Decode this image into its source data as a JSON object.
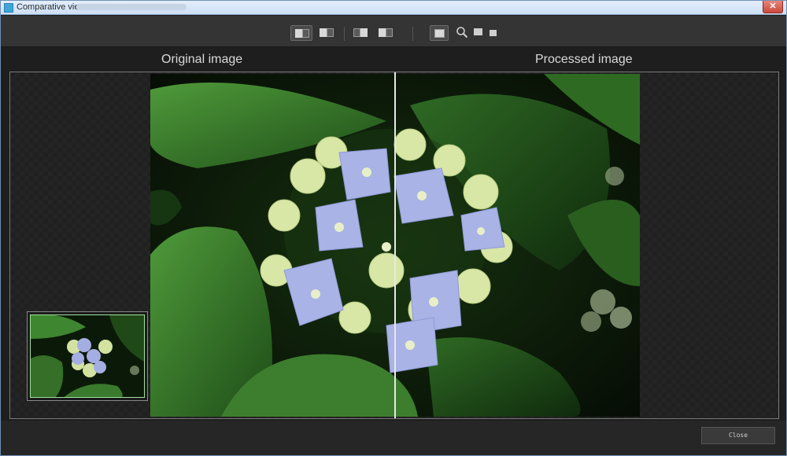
{
  "window": {
    "title": "Comparative view",
    "close_glyph": "✕"
  },
  "toolbar": {
    "buttons": [
      {
        "name": "split-view-vertical",
        "icon": "split-vertical-icon",
        "active": true
      },
      {
        "name": "split-view-alt",
        "icon": "split-alt-icon",
        "active": false
      },
      {
        "name": "side-by-side-left",
        "icon": "side-left-icon",
        "active": false
      },
      {
        "name": "side-by-side-right",
        "icon": "side-right-icon",
        "active": false
      },
      {
        "name": "single-view",
        "icon": "single-view-icon",
        "active": true
      },
      {
        "name": "zoom",
        "icon": "magnifier-icon",
        "active": false
      },
      {
        "name": "fit-to-window",
        "icon": "fit-icon",
        "active": false
      },
      {
        "name": "actual-size",
        "icon": "actual-size-icon",
        "active": false
      }
    ]
  },
  "labels": {
    "original": "Original image",
    "processed": "Processed image"
  },
  "footer": {
    "close_label": "Close"
  },
  "colors": {
    "accent_frame": "#9fe09f",
    "divider": "#e8e8e8",
    "background": "#1e1e1e"
  }
}
